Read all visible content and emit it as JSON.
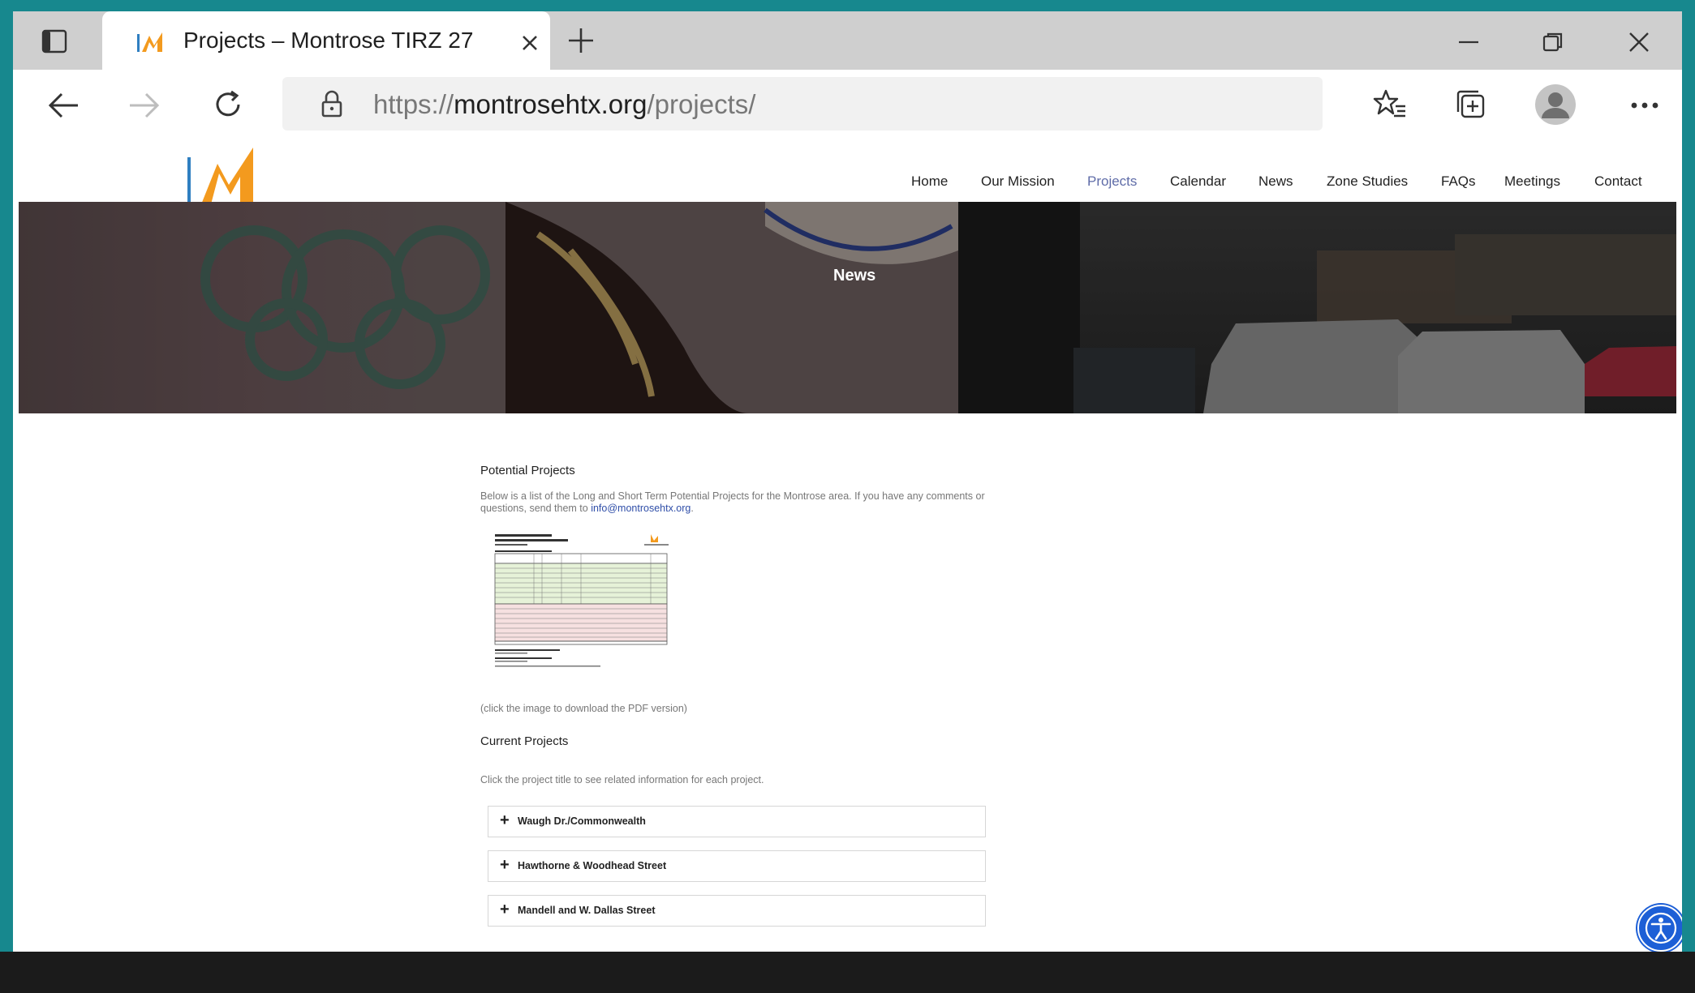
{
  "browser": {
    "tab_title": "Projects – Montrose TIRZ 27",
    "url_scheme": "https://",
    "url_host": "montrosehtx.org",
    "url_path": "/projects/"
  },
  "nav": {
    "items": [
      {
        "label": "Home",
        "active": false
      },
      {
        "label": "Our Mission",
        "active": false
      },
      {
        "label": "Projects",
        "active": true
      },
      {
        "label": "Calendar",
        "active": false
      },
      {
        "label": "News",
        "active": false
      },
      {
        "label": "Zone Studies",
        "active": false
      },
      {
        "label": "FAQs",
        "active": false
      },
      {
        "label": "Meetings",
        "active": false
      },
      {
        "label": "Contact",
        "active": false
      }
    ]
  },
  "hero": {
    "title": "News"
  },
  "potential": {
    "heading": "Potential Projects",
    "intro_text": "Below is a list of the Long and Short Term Potential Projects for the Montrose area. If you have any comments or questions, send them to ",
    "email": "info@montrosehtx.org",
    "intro_end": ".",
    "download_note": "(click the image to download the PDF version)"
  },
  "current": {
    "heading": "Current Projects",
    "instructions": "Click the project title to see related information for each project.",
    "projects": [
      {
        "title": "Waugh Dr./Commonwealth"
      },
      {
        "title": "Hawthorne & Woodhead Street"
      },
      {
        "title": "Mandell and W. Dallas Street"
      }
    ]
  },
  "colors": {
    "accent": "#5f6ca8",
    "logo_orange": "#f39a1e",
    "logo_blue": "#2f7fc1",
    "a11y_blue": "#1d5fd6"
  }
}
